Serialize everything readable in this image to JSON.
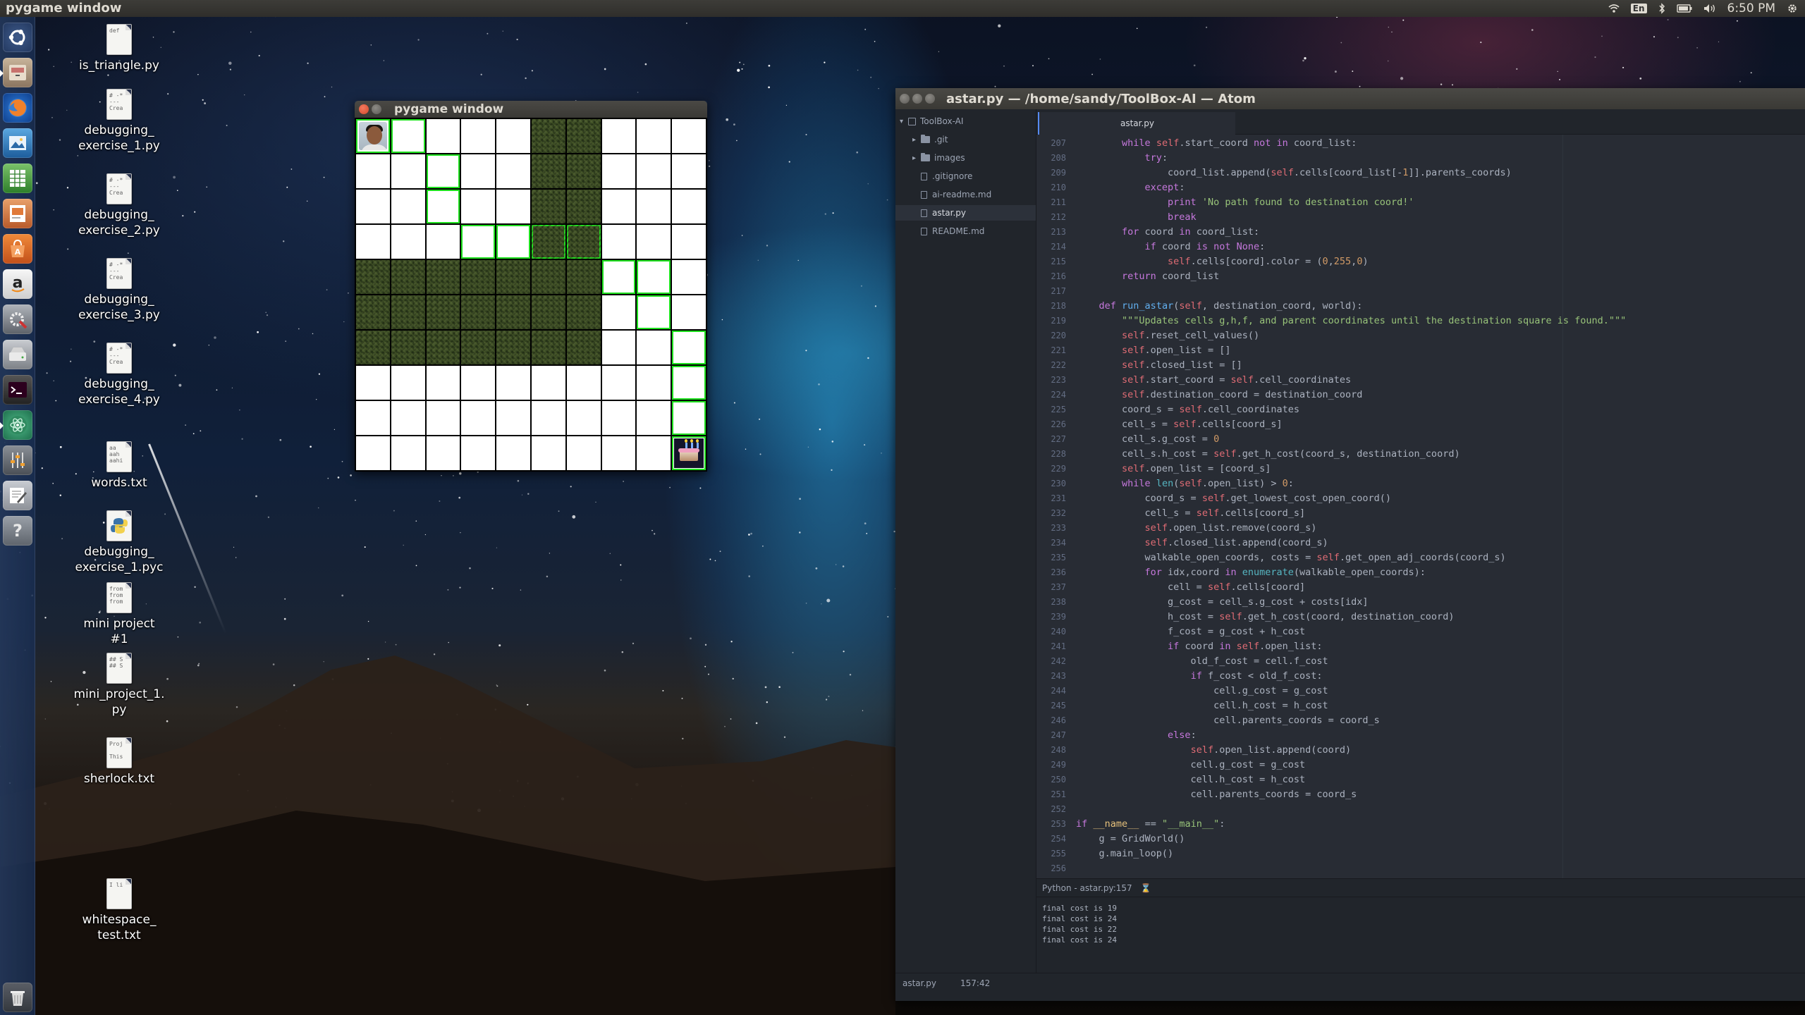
{
  "top_panel": {
    "app_title": "pygame window",
    "keyboard": "En",
    "clock": "6:50 PM"
  },
  "launcher": {
    "items": [
      {
        "name": "dash-home",
        "icon": "ubuntu-logo-icon"
      },
      {
        "name": "files",
        "icon": "file-cabinet-icon"
      },
      {
        "name": "firefox",
        "icon": "firefox-icon"
      },
      {
        "name": "image-viewer",
        "icon": "image-viewer-icon"
      },
      {
        "name": "libreoffice-calc",
        "icon": "spreadsheet-icon"
      },
      {
        "name": "libreoffice-impress",
        "icon": "presentation-icon"
      },
      {
        "name": "software-center",
        "icon": "shopping-bag-icon"
      },
      {
        "name": "amazon",
        "icon": "amazon-icon"
      },
      {
        "name": "system-settings",
        "icon": "settings-wrench-icon"
      },
      {
        "name": "disk",
        "icon": "hard-drive-icon"
      },
      {
        "name": "terminal",
        "icon": "terminal-icon"
      },
      {
        "name": "atom",
        "icon": "atom-icon"
      },
      {
        "name": "mixer",
        "icon": "sliders-icon"
      },
      {
        "name": "text-editor",
        "icon": "text-editor-icon"
      },
      {
        "name": "help",
        "icon": "help-icon"
      },
      {
        "name": "trash",
        "icon": "trash-icon"
      }
    ]
  },
  "desktop_icons": [
    {
      "label": "is_triangle.py",
      "preview": "def"
    },
    {
      "label": "debugging_\nexercise_1.py",
      "preview": "# -*\n---\nCrea"
    },
    {
      "label": "debugging_\nexercise_2.py",
      "preview": "# -*\n---\nCrea"
    },
    {
      "label": "debugging_\nexercise_3.py",
      "preview": "# -*\n---\nCrea"
    },
    {
      "label": "debugging_\nexercise_4.py",
      "preview": "# -*\n---\nCrea"
    },
    {
      "label": "words.txt",
      "preview": "aa\naah\naahi"
    },
    {
      "label": "debugging_\nexercise_1.pyc",
      "preview": ""
    },
    {
      "label": "mini project #1",
      "preview": "from\nfrom\nfrom"
    },
    {
      "label": "mini_project_1.\npy",
      "preview": "## S\n## S"
    },
    {
      "label": "sherlock.txt",
      "preview": "Proj\n\nThis"
    },
    {
      "label": "whitespace_\ntest.txt",
      "preview": "I li"
    }
  ],
  "pygame_window": {
    "title": "pygame window",
    "grid": {
      "rows": 10,
      "cols": 10,
      "walls": [
        [
          0,
          5
        ],
        [
          0,
          6
        ],
        [
          1,
          5
        ],
        [
          1,
          6
        ],
        [
          2,
          5
        ],
        [
          2,
          6
        ],
        [
          3,
          5
        ],
        [
          3,
          6
        ],
        [
          4,
          0
        ],
        [
          4,
          1
        ],
        [
          4,
          2
        ],
        [
          4,
          3
        ],
        [
          4,
          4
        ],
        [
          4,
          5
        ],
        [
          4,
          6
        ],
        [
          5,
          0
        ],
        [
          5,
          1
        ],
        [
          5,
          2
        ],
        [
          5,
          3
        ],
        [
          5,
          4
        ],
        [
          5,
          5
        ],
        [
          5,
          6
        ],
        [
          6,
          0
        ],
        [
          6,
          1
        ],
        [
          6,
          2
        ],
        [
          6,
          3
        ],
        [
          6,
          4
        ],
        [
          6,
          5
        ],
        [
          6,
          6
        ]
      ],
      "path": [
        [
          0,
          0
        ],
        [
          0,
          1
        ],
        [
          1,
          2
        ],
        [
          2,
          2
        ],
        [
          3,
          3
        ],
        [
          3,
          4
        ],
        [
          3,
          5
        ],
        [
          3,
          6
        ],
        [
          4,
          7
        ],
        [
          4,
          8
        ],
        [
          5,
          8
        ],
        [
          6,
          9
        ],
        [
          7,
          9
        ],
        [
          8,
          9
        ],
        [
          9,
          9
        ]
      ],
      "start": [
        0,
        0
      ],
      "goal": [
        9,
        9
      ]
    }
  },
  "atom": {
    "title": "astar.py — /home/sandy/ToolBox-AI — Atom",
    "tree": [
      {
        "label": "ToolBox-AI",
        "type": "repo",
        "depth": 0,
        "expanded": true
      },
      {
        "label": ".git",
        "type": "folder",
        "depth": 1
      },
      {
        "label": "images",
        "type": "folder",
        "depth": 1
      },
      {
        "label": ".gitignore",
        "type": "file",
        "depth": 1
      },
      {
        "label": "ai-readme.md",
        "type": "file",
        "depth": 1
      },
      {
        "label": "astar.py",
        "type": "file",
        "depth": 1,
        "selected": true
      },
      {
        "label": "README.md",
        "type": "file",
        "depth": 1
      }
    ],
    "tab": "astar.py",
    "code": [
      {
        "n": "207",
        "text": "        while self.start_coord not in coord_list:"
      },
      {
        "n": "208",
        "text": "            try:"
      },
      {
        "n": "209",
        "text": "                coord_list.append(self.cells[coord_list[-1]].parents_coords)"
      },
      {
        "n": "210",
        "text": "            except:"
      },
      {
        "n": "211",
        "text": "                print 'No path found to destination coord!'"
      },
      {
        "n": "212",
        "text": "                break"
      },
      {
        "n": "213",
        "text": "        for coord in coord_list:"
      },
      {
        "n": "214",
        "text": "            if coord is not None:"
      },
      {
        "n": "215",
        "text": "                self.cells[coord].color = (0,255,0)"
      },
      {
        "n": "216",
        "text": "        return coord_list"
      },
      {
        "n": "217",
        "text": ""
      },
      {
        "n": "218",
        "text": "    def run_astar(self, destination_coord, world):"
      },
      {
        "n": "219",
        "text": "        \"\"\"Updates cells g,h,f, and parent coordinates until the destination square is found.\"\"\""
      },
      {
        "n": "220",
        "text": "        self.reset_cell_values()"
      },
      {
        "n": "221",
        "text": "        self.open_list = []"
      },
      {
        "n": "222",
        "text": "        self.closed_list = []"
      },
      {
        "n": "223",
        "text": "        self.start_coord = self.cell_coordinates"
      },
      {
        "n": "224",
        "text": "        self.destination_coord = destination_coord"
      },
      {
        "n": "225",
        "text": "        coord_s = self.cell_coordinates"
      },
      {
        "n": "226",
        "text": "        cell_s = self.cells[coord_s]"
      },
      {
        "n": "227",
        "text": "        cell_s.g_cost = 0"
      },
      {
        "n": "228",
        "text": "        cell_s.h_cost = self.get_h_cost(coord_s, destination_coord)"
      },
      {
        "n": "229",
        "text": "        self.open_list = [coord_s]"
      },
      {
        "n": "230",
        "text": "        while len(self.open_list) > 0:"
      },
      {
        "n": "231",
        "text": "            coord_s = self.get_lowest_cost_open_coord()"
      },
      {
        "n": "232",
        "text": "            cell_s = self.cells[coord_s]"
      },
      {
        "n": "233",
        "text": "            self.open_list.remove(coord_s)"
      },
      {
        "n": "234",
        "text": "            self.closed_list.append(coord_s)"
      },
      {
        "n": "235",
        "text": "            walkable_open_coords, costs = self.get_open_adj_coords(coord_s)"
      },
      {
        "n": "236",
        "text": "            for idx,coord in enumerate(walkable_open_coords):"
      },
      {
        "n": "237",
        "text": "                cell = self.cells[coord]"
      },
      {
        "n": "238",
        "text": "                g_cost = cell_s.g_cost + costs[idx]"
      },
      {
        "n": "239",
        "text": "                h_cost = self.get_h_cost(coord, destination_coord)"
      },
      {
        "n": "240",
        "text": "                f_cost = g_cost + h_cost"
      },
      {
        "n": "241",
        "text": "                if coord in self.open_list:"
      },
      {
        "n": "242",
        "text": "                    old_f_cost = cell.f_cost"
      },
      {
        "n": "243",
        "text": "                    if f_cost < old_f_cost:"
      },
      {
        "n": "244",
        "text": "                        cell.g_cost = g_cost"
      },
      {
        "n": "245",
        "text": "                        cell.h_cost = h_cost"
      },
      {
        "n": "246",
        "text": "                        cell.parents_coords = coord_s"
      },
      {
        "n": "247",
        "text": "                else:"
      },
      {
        "n": "248",
        "text": "                    self.open_list.append(coord)"
      },
      {
        "n": "249",
        "text": "                    cell.g_cost = g_cost"
      },
      {
        "n": "250",
        "text": "                    cell.h_cost = h_cost"
      },
      {
        "n": "251",
        "text": "                    cell.parents_coords = coord_s"
      },
      {
        "n": "252",
        "text": ""
      },
      {
        "n": "253",
        "text": "if __name__ == \"__main__\":"
      },
      {
        "n": "254",
        "text": "    g = GridWorld()"
      },
      {
        "n": "255",
        "text": "    g.main_loop()"
      },
      {
        "n": "256",
        "text": ""
      }
    ],
    "panel_title": "Python - astar.py:157",
    "output": [
      "final cost is 19",
      "final cost is 24",
      "final cost is 22",
      "final cost is 24"
    ],
    "status_file": "astar.py",
    "status_pos": "157:42"
  }
}
